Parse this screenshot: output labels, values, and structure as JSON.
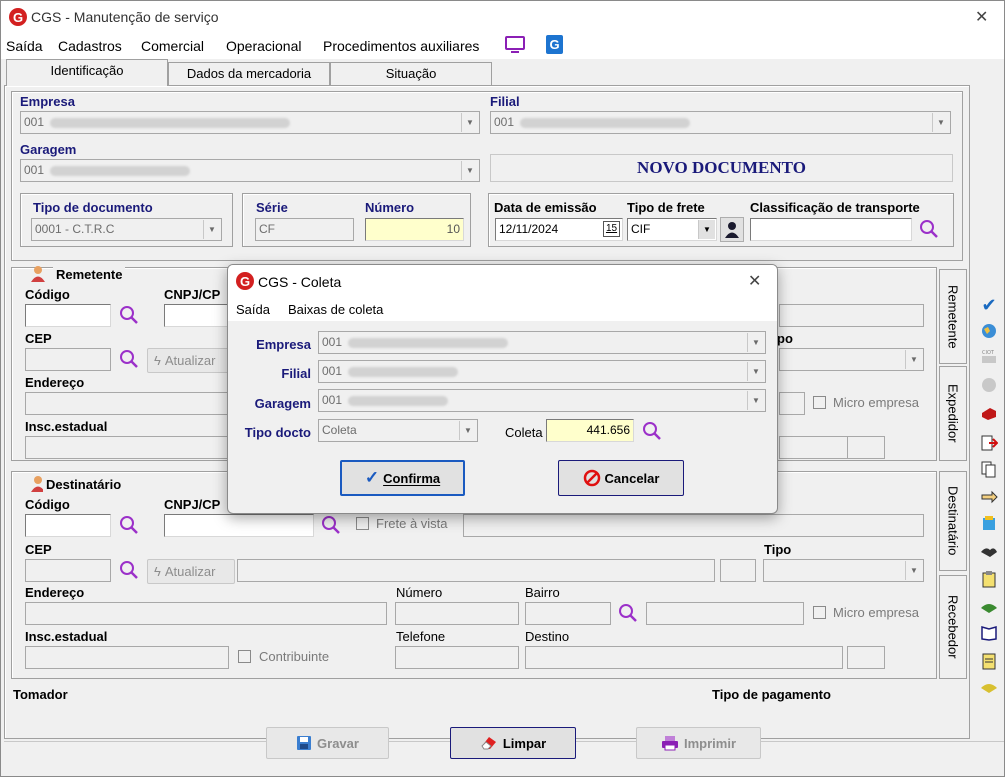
{
  "window": {
    "title": "CGS - Manutenção de serviço",
    "close": "✕"
  },
  "menu": {
    "items": [
      "Saída",
      "Cadastros",
      "Comercial",
      "Operacional",
      "Procedimentos auxiliares"
    ]
  },
  "tabs": [
    "Identificação",
    "Dados da mercadoria",
    "Situação"
  ],
  "empresa": {
    "label": "Empresa",
    "value": "001"
  },
  "filial": {
    "label": "Filial",
    "value": "001"
  },
  "garagem": {
    "label": "Garagem",
    "value": "001"
  },
  "novo_documento": "NOVO DOCUMENTO",
  "tipo_documento": {
    "label": "Tipo de documento",
    "value": "0001 - C.T.R.C"
  },
  "serie": {
    "label": "Série",
    "value": "CF"
  },
  "numero": {
    "label": "Número",
    "value": "10"
  },
  "data_emissao": {
    "label": "Data de emissão",
    "value": "12/11/2024",
    "cal": "15"
  },
  "tipo_frete": {
    "label": "Tipo de frete",
    "value": "CIF"
  },
  "classificacao": {
    "label": "Classificação de transporte",
    "value": ""
  },
  "remetente": {
    "title": "Remetente",
    "codigo": "Código",
    "cnpj": "CNPJ/CP",
    "cep": "CEP",
    "atualizar": "Atualizar",
    "endereco": "Endereço",
    "insc": "Insc.estadual",
    "tipo": "po",
    "micro": "Micro empresa"
  },
  "destinatario": {
    "title": "Destinatário",
    "codigo": "Código",
    "cnpj": "CNPJ/CP",
    "frete_vista": "Frete à vista",
    "cep": "CEP",
    "atualizar": "Atualizar",
    "tipo": "Tipo",
    "endereco": "Endereço",
    "numero": "Número",
    "bairro": "Bairro",
    "micro": "Micro empresa",
    "insc": "Insc.estadual",
    "contribuinte": "Contribuinte",
    "telefone": "Telefone",
    "destino": "Destino"
  },
  "side_tabs": [
    "Remetente",
    "Expedidor",
    "Destinatário",
    "Recebedor"
  ],
  "tomador": "Tomador",
  "tipo_pagamento": "Tipo de pagamento",
  "buttons": {
    "gravar": "Gravar",
    "limpar": "Limpar",
    "imprimir": "Imprimir"
  },
  "dialog": {
    "title": "CGS - Coleta",
    "menu": [
      "Saída",
      "Baixas de coleta"
    ],
    "empresa_label": "Empresa",
    "empresa_value": "001",
    "filial_label": "Filial",
    "filial_value": "001",
    "garagem_label": "Garagem",
    "garagem_value": "001",
    "tipo_docto_label": "Tipo docto",
    "tipo_docto_value": "Coleta",
    "coleta_label": "Coleta",
    "coleta_value": "441.656",
    "confirma": "Confirma",
    "cancelar": "Cancelar"
  },
  "colors": {
    "accent": "#1a1a7a",
    "logo": "#d32020",
    "yellow_field": "#ffffcc"
  }
}
